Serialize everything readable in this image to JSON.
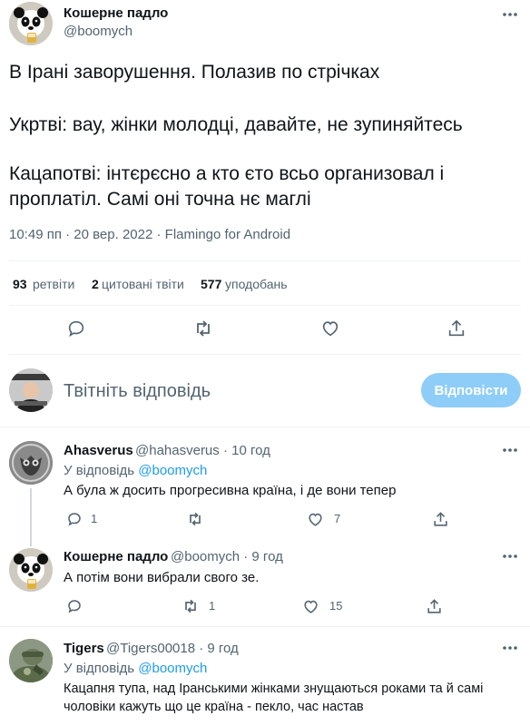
{
  "main_tweet": {
    "author_name": "Кошерне падло",
    "author_handle": "@boomych",
    "text_line1": "В Ірані заворушення. Полазив по стрічках",
    "text_line2": "Укртві: вау, жінки молодці, давайте, не зупиняйтесь",
    "text_line3": "Кацапотві: інтєрєсно а кто єто всьо организовал і",
    "text_line4": "проплатіл. Самі оні точна нє маглі",
    "meta": "10:49 пп · 20 вер. 2022 · Flamingo for Android",
    "stats": {
      "retweets_count": "93",
      "retweets_label": "ретвіти",
      "quotes_count": "2",
      "quotes_label": "цитовані твіти",
      "likes_count": "577",
      "likes_label": "уподобань"
    }
  },
  "reply_box": {
    "placeholder": "Твітніть відповідь",
    "button_label": "Відповісти"
  },
  "replies": [
    {
      "name": "Ahasverus",
      "handle_time": "@hahasverus · 10 год",
      "reply_to_prefix": "У відповідь",
      "reply_to_handle": "@boomych",
      "text": "А була ж досить прогресивна країна, і де вони тепер",
      "retweets": "",
      "likes": "7"
    },
    {
      "name": "Кошерне падло",
      "handle_time": "@boomych · 9 год",
      "text": "А потім вони вибрали свого зе.",
      "retweets": "1",
      "likes": "15"
    },
    {
      "name": "Tigers",
      "handle_time": "@Tigers00018 · 9 год",
      "reply_to_prefix": "У відповідь",
      "reply_to_handle": "@boomych",
      "text_line1": "Кацапня тупа, над Іранськими жінками знущаються роками та й самі",
      "text_line2": "чоловіки кажуть що це країна - пекло, час настав"
    }
  ],
  "colors": {
    "accent": "#1d9bf0",
    "reply_button_bg": "#8ecdf8",
    "muted_text": "#536471",
    "divider": "#eff3f4"
  }
}
